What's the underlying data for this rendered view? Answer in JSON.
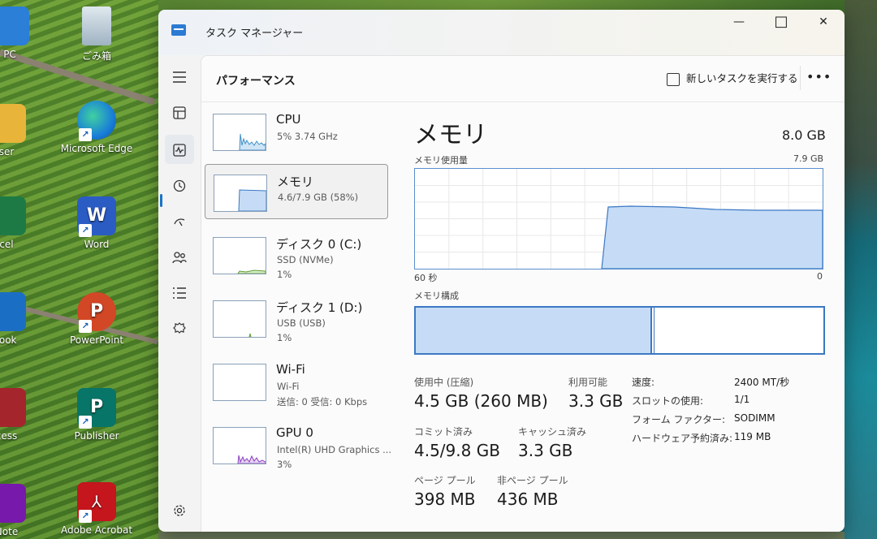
{
  "desktop": {
    "icons": [
      {
        "label": "PC"
      },
      {
        "label": "ごみ箱"
      },
      {
        "label": "ser"
      },
      {
        "label": "Microsoft Edge"
      },
      {
        "label": "cel"
      },
      {
        "label": "Word"
      },
      {
        "label": "look"
      },
      {
        "label": "PowerPoint"
      },
      {
        "label": "cess"
      },
      {
        "label": "Publisher"
      },
      {
        "label": "Note"
      },
      {
        "label": "Adobe Acrobat"
      }
    ]
  },
  "window": {
    "title": "タスク マネージャー",
    "minimize": "—",
    "maximize": "□",
    "close": "✕"
  },
  "nav": {
    "items": [
      "hamburger-icon",
      "processes-icon",
      "performance-icon",
      "history-icon",
      "startup-icon",
      "users-icon",
      "details-icon",
      "services-icon"
    ],
    "settings": "settings-icon"
  },
  "header": {
    "title": "パフォーマンス",
    "new_task": "新しいタスクを実行する",
    "more": "•••"
  },
  "list": [
    {
      "name": "CPU",
      "sub": "5%  3.74 GHz",
      "sub2": ""
    },
    {
      "name": "メモリ",
      "sub": "4.6/7.9 GB (58%)",
      "sub2": ""
    },
    {
      "name": "ディスク 0 (C:)",
      "sub": "SSD (NVMe)",
      "sub2": "1%"
    },
    {
      "name": "ディスク 1 (D:)",
      "sub": "USB (USB)",
      "sub2": "1%"
    },
    {
      "name": "Wi-Fi",
      "sub": "Wi-Fi",
      "sub2": "送信: 0  受信: 0 Kbps"
    },
    {
      "name": "GPU 0",
      "sub": "Intel(R) UHD Graphics ...",
      "sub2": "3%"
    }
  ],
  "memory": {
    "title": "メモリ",
    "total": "8.0 GB",
    "usage_label": "メモリ使用量",
    "usage_max": "7.9 GB",
    "axis_left": "60 秒",
    "axis_right": "0",
    "composition_label": "メモリ構成",
    "in_use_label": "使用中 (圧縮)",
    "in_use_value": "4.5 GB (260 MB)",
    "available_label": "利用可能",
    "available_value": "3.3 GB",
    "committed_label": "コミット済み",
    "committed_value": "4.5/9.8 GB",
    "cached_label": "キャッシュ済み",
    "cached_value": "3.3 GB",
    "paged_label": "ページ プール",
    "paged_value": "398 MB",
    "nonpaged_label": "非ページ プール",
    "nonpaged_value": "436 MB",
    "specs": [
      {
        "k": "速度:",
        "v": "2400 MT/秒"
      },
      {
        "k": "スロットの使用:",
        "v": "1/1"
      },
      {
        "k": "フォーム ファクター:",
        "v": "SODIMM"
      },
      {
        "k": "ハードウェア予約済み:",
        "v": "119 MB"
      }
    ],
    "in_use_fraction": 0.58
  }
}
